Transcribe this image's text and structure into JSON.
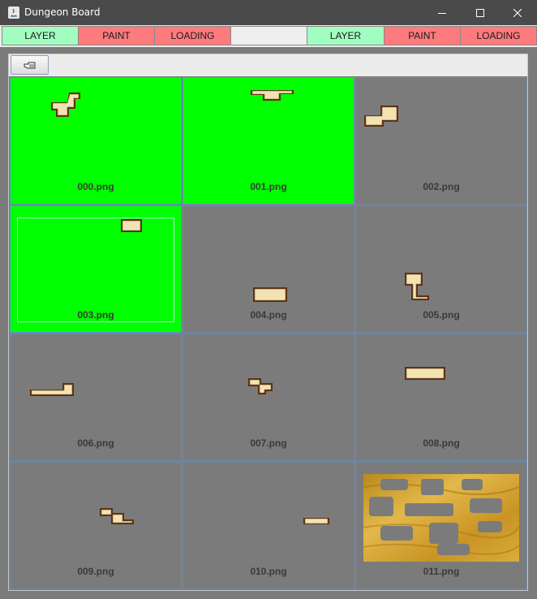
{
  "window": {
    "title": "Dungeon Board"
  },
  "toolbar": {
    "left": [
      {
        "label": "LAYER",
        "kind": "layer"
      },
      {
        "label": "PAINT",
        "kind": "paint"
      },
      {
        "label": "LOADING",
        "kind": "loading"
      }
    ],
    "right": [
      {
        "label": "LAYER",
        "kind": "layer"
      },
      {
        "label": "PAINT",
        "kind": "paint"
      },
      {
        "label": "LOADING",
        "kind": "loading"
      }
    ]
  },
  "panel": {
    "back_icon": "hand-pointer-icon"
  },
  "tiles": [
    {
      "label": "000.png",
      "active": true
    },
    {
      "label": "001.png",
      "active": true
    },
    {
      "label": "002.png",
      "active": false
    },
    {
      "label": "003.png",
      "active": true,
      "focused": true
    },
    {
      "label": "004.png",
      "active": false
    },
    {
      "label": "005.png",
      "active": false
    },
    {
      "label": "006.png",
      "active": false
    },
    {
      "label": "007.png",
      "active": false
    },
    {
      "label": "008.png",
      "active": false
    },
    {
      "label": "009.png",
      "active": false
    },
    {
      "label": "010.png",
      "active": false
    },
    {
      "label": "011.png",
      "active": false
    }
  ],
  "colors": {
    "active": "#00ff00",
    "layer": "#a2fdc0",
    "paint": "#fd7b7c",
    "background": "#7b7b7b"
  }
}
